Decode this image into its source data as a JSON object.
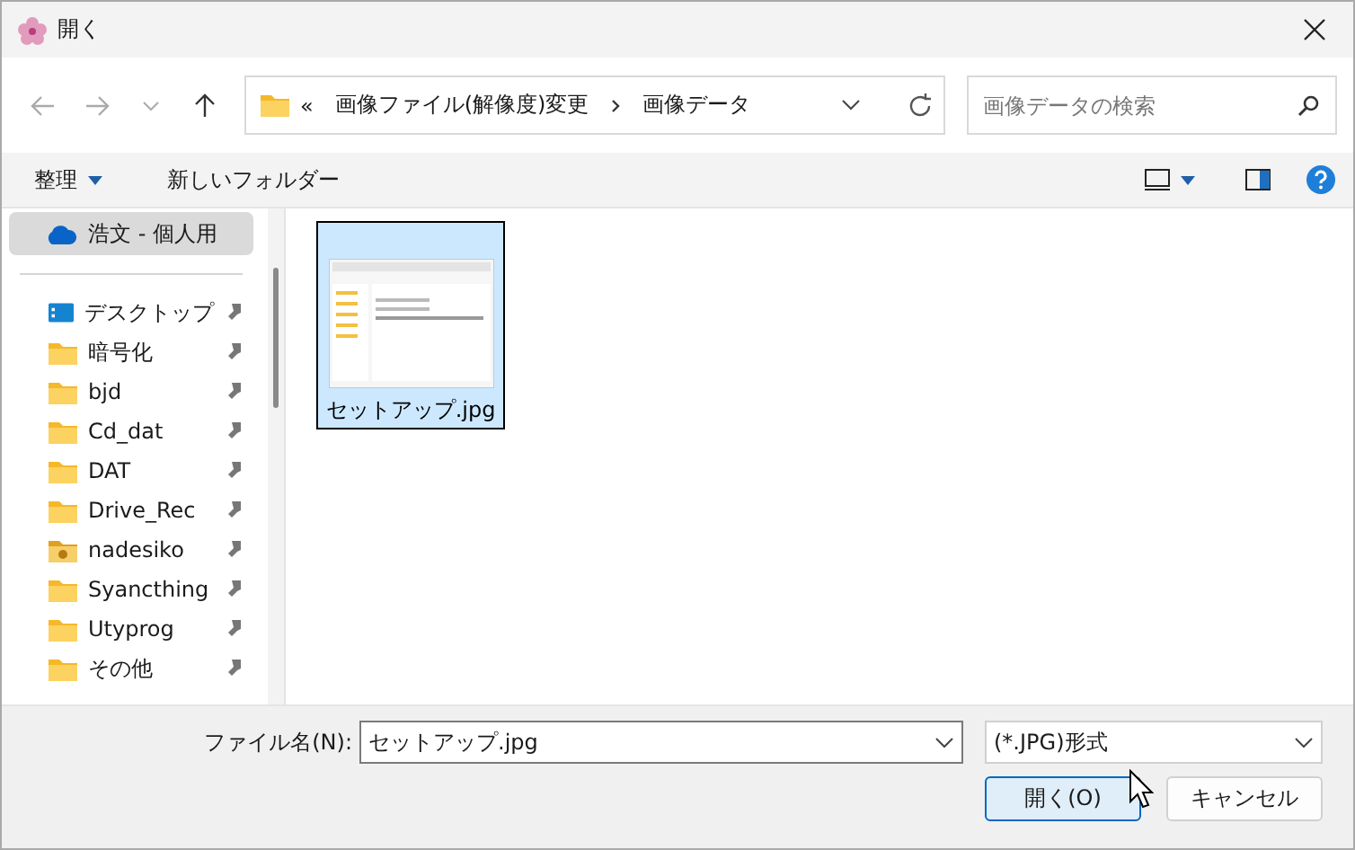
{
  "window": {
    "title": "開く"
  },
  "address": {
    "overflow": "«",
    "segments": [
      "画像ファイル(解像度)変更",
      "画像データ"
    ]
  },
  "search": {
    "placeholder": "画像データの検索"
  },
  "toolbar": {
    "organize": "整理",
    "new_folder": "新しいフォルダー"
  },
  "sidebar": {
    "items": [
      {
        "kind": "cloud",
        "label": "浩文 - 個人用",
        "selected": true,
        "pinned": false
      },
      {
        "kind": "desktop",
        "label": "デスクトップ",
        "selected": false,
        "pinned": true
      },
      {
        "kind": "folder",
        "label": "暗号化",
        "selected": false,
        "pinned": true
      },
      {
        "kind": "folder",
        "label": "bjd",
        "selected": false,
        "pinned": true
      },
      {
        "kind": "folder",
        "label": "Cd_dat",
        "selected": false,
        "pinned": true
      },
      {
        "kind": "folder",
        "label": "DAT",
        "selected": false,
        "pinned": true
      },
      {
        "kind": "folder",
        "label": "Drive_Rec",
        "selected": false,
        "pinned": true
      },
      {
        "kind": "app-folder",
        "label": "nadesiko",
        "selected": false,
        "pinned": true
      },
      {
        "kind": "folder",
        "label": "Syancthing",
        "selected": false,
        "pinned": true
      },
      {
        "kind": "folder",
        "label": "Utyprog",
        "selected": false,
        "pinned": true
      },
      {
        "kind": "folder",
        "label": "その他",
        "selected": false,
        "pinned": true
      }
    ]
  },
  "files": [
    {
      "name": "セットアップ.jpg",
      "selected": true
    }
  ],
  "footer": {
    "filename_label": "ファイル名(N):",
    "filename": "セットアップ.jpg",
    "filetype": "(*.JPG)形式",
    "open_button": "開く(O)",
    "cancel_button": "キャンセル"
  }
}
